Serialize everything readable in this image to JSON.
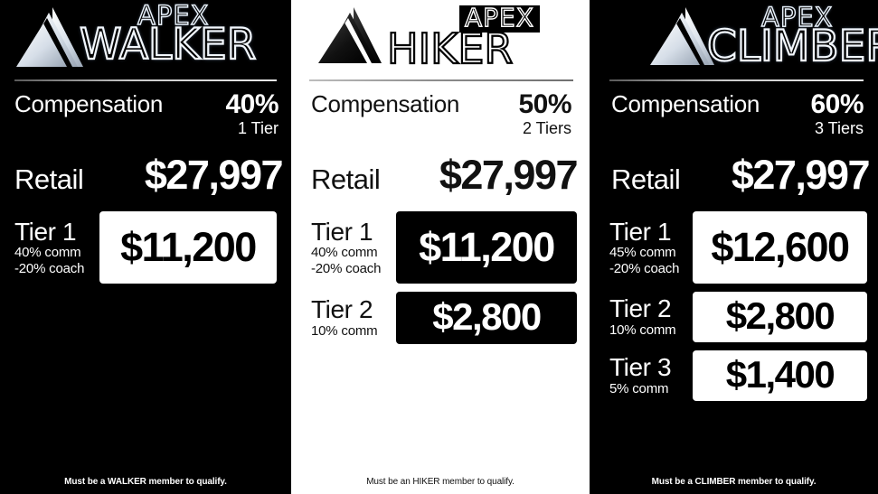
{
  "panels": [
    {
      "id": "walker",
      "theme": "dark",
      "logo": {
        "icon": "apex-mountain-logo",
        "apex_text": "APEX",
        "tier_text": "WALKER"
      },
      "compensation": {
        "label": "Compensation",
        "percent": "40%",
        "tiers_text": "1 Tier"
      },
      "retail": {
        "label": "Retail",
        "value": "$27,997"
      },
      "tiers": [
        {
          "name": "Tier 1",
          "sub_lines": [
            "40% comm",
            "-20% coach"
          ],
          "amount": "$11,200"
        }
      ],
      "footer": "Must be a WALKER member to qualify."
    },
    {
      "id": "hiker",
      "theme": "light",
      "logo": {
        "icon": "apex-mountain-logo",
        "apex_text": "APEX",
        "tier_text": "HIKER"
      },
      "compensation": {
        "label": "Compensation",
        "percent": "50%",
        "tiers_text": "2 Tiers"
      },
      "retail": {
        "label": "Retail",
        "value": "$27,997"
      },
      "tiers": [
        {
          "name": "Tier 1",
          "sub_lines": [
            "40% comm",
            "-20% coach"
          ],
          "amount": "$11,200"
        },
        {
          "name": "Tier 2",
          "sub_lines": [
            "10% comm"
          ],
          "amount": "$2,800"
        }
      ],
      "footer": "Must be an HIKER member to qualify."
    },
    {
      "id": "climber",
      "theme": "dark",
      "logo": {
        "icon": "apex-mountain-logo",
        "apex_text": "APEX",
        "tier_text": "CLIMBER"
      },
      "compensation": {
        "label": "Compensation",
        "percent": "60%",
        "tiers_text": "3 Tiers"
      },
      "retail": {
        "label": "Retail",
        "value": "$27,997"
      },
      "tiers": [
        {
          "name": "Tier 1",
          "sub_lines": [
            "45% comm",
            "-20% coach"
          ],
          "amount": "$12,600"
        },
        {
          "name": "Tier 2",
          "sub_lines": [
            "10% comm"
          ],
          "amount": "$2,800"
        },
        {
          "name": "Tier 3",
          "sub_lines": [
            "5% comm"
          ],
          "amount": "$1,400"
        }
      ],
      "footer": "Must be a CLIMBER member to qualify."
    }
  ],
  "colors": {
    "dark_bg": "#000000",
    "light_bg": "#ffffff",
    "dark_text": "#111111",
    "light_text": "#ffffff"
  }
}
